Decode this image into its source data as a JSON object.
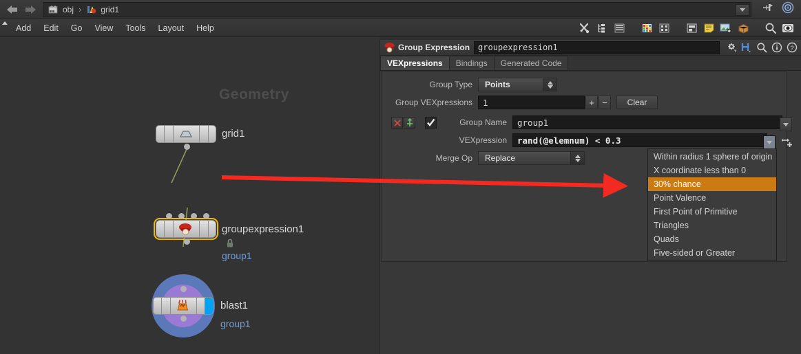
{
  "app": {
    "title": "Houdini Network Editor",
    "accent_orange": "#cc7a12",
    "accent_yellow": "#f0b800",
    "link_blue": "#6f9dd6"
  },
  "topbar": {
    "back_icon": "back-arrow-icon",
    "forward_icon": "forward-arrow-icon",
    "breadcrumb": [
      {
        "icon": "obj-network-icon",
        "label": "obj"
      },
      {
        "icon": "geometry-node-icon",
        "label": "grid1"
      }
    ],
    "crumb_separator": "›",
    "dropdown_icon": "chevron-down-icon",
    "right_icons": [
      "pin-panel-icon",
      "target-selector-icon"
    ]
  },
  "menubar": {
    "handle_icon": "menu-handle-icon",
    "items": [
      "Add",
      "Edit",
      "Go",
      "View",
      "Tools",
      "Layout",
      "Help"
    ],
    "right_icons": [
      "tools-icon",
      "tree-view-icon",
      "list-view-icon",
      "color-palette-icon",
      "grid-layout-icon",
      "panel-layout-icon",
      "notes-icon",
      "add-image-icon",
      "box-icon",
      "search-icon",
      "display-eye-icon"
    ]
  },
  "network": {
    "watermark": "Geometry",
    "nodes": [
      {
        "name": "grid1",
        "label": "grid1",
        "sublabel": "",
        "glyph": "grid-node-icon",
        "selected": false,
        "flagged": false
      },
      {
        "name": "groupexpression1",
        "label": "groupexpression1",
        "sublabel": "group1",
        "glyph": "group-expression-node-icon",
        "selected": true,
        "flagged": false
      },
      {
        "name": "blast1",
        "label": "blast1",
        "sublabel": "group1",
        "glyph": "blast-node-icon",
        "selected": false,
        "flagged": true
      }
    ],
    "lock_icon": "lock-icon",
    "annotation_arrow": {
      "name": "red-annotation-arrow",
      "color": "#f22a22"
    }
  },
  "parm_panel": {
    "header": {
      "icon": "group-expression-icon",
      "title": "Group Expression",
      "node_path": "groupexpression1",
      "tools": [
        "gear-icon",
        "houdini-h-icon",
        "search-icon",
        "info-icon",
        "help-icon"
      ]
    },
    "tabs": [
      {
        "label": "VEXpressions",
        "active": true
      },
      {
        "label": "Bindings",
        "active": false
      },
      {
        "label": "Generated Code",
        "active": false
      }
    ],
    "rows": {
      "group_type": {
        "label": "Group Type",
        "value": "Points"
      },
      "group_vexpressions": {
        "label": "Group VEXpressions",
        "value": "1",
        "add_label": "+",
        "remove_label": "−",
        "clear_label": "Clear"
      },
      "multiparm_controls": {
        "delete_icon": "delete-instance-icon",
        "move_icon": "move-instance-icon",
        "enable_checkbox": "enabled-checkmark-icon"
      },
      "group_name": {
        "label": "Group Name",
        "value": "group1",
        "dropdown_icon": "chevron-down-icon"
      },
      "vexpression": {
        "label": "VEXpression",
        "value": "rand(@elemnum) < 0.3",
        "dropdown_icon": "chevron-down-icon",
        "expand_icon": "expand-editor-icon"
      },
      "merge_op": {
        "label": "Merge Op",
        "value": "Replace"
      }
    }
  },
  "popup_menu": {
    "name": "vexpression-presets-menu",
    "items": [
      {
        "label": "Within radius 1 sphere of origin",
        "selected": false
      },
      {
        "label": "X coordinate less than 0",
        "selected": false
      },
      {
        "label": "30% chance",
        "selected": true
      },
      {
        "label": "Point Valence",
        "selected": false
      },
      {
        "label": "First Point of Primitive",
        "selected": false
      },
      {
        "label": "Triangles",
        "selected": false
      },
      {
        "label": "Quads",
        "selected": false
      },
      {
        "label": "Five-sided or Greater",
        "selected": false
      }
    ]
  }
}
